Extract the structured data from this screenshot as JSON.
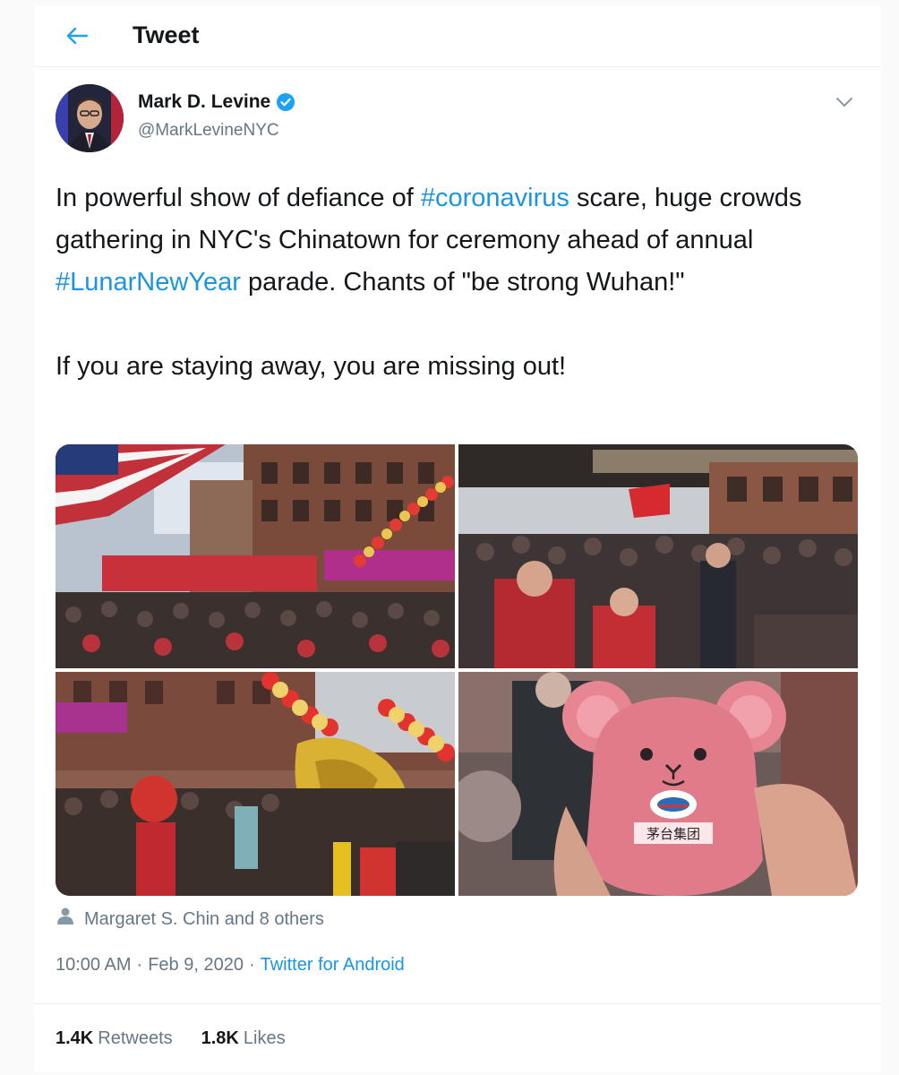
{
  "header": {
    "back_icon": "back-arrow-icon",
    "title": "Tweet"
  },
  "author": {
    "name": "Mark D. Levine",
    "handle": "@MarkLevineNYC",
    "verified_icon": "verified-badge-icon"
  },
  "tweet": {
    "line1_pre": "In powerful show of defiance of ",
    "hashtag1": "#coronavirus",
    "line1_post": " scare, huge crowds gathering in NYC's Chinatown for ceremony ahead of annual ",
    "hashtag2": "#LunarNewYear",
    "line1_end": " parade. Chants of \"be strong Wuhan!\"",
    "line2": "If you are staying away, you are missing out!"
  },
  "media": {
    "photos": [
      "street-crowd-banner-photo",
      "crowd-under-awning-photo",
      "lion-dance-balloons-photo",
      "pink-rat-mascot-photo"
    ]
  },
  "tagged": {
    "icon": "person-icon",
    "text": "Margaret S. Chin and 8 others"
  },
  "meta": {
    "time": "10:00 AM",
    "date": "Feb 9, 2020",
    "separator": "·",
    "source": "Twitter for Android"
  },
  "stats": {
    "retweets_count": "1.4K",
    "retweets_label": "Retweets",
    "likes_count": "1.8K",
    "likes_label": "Likes"
  },
  "colors": {
    "accent": "#1da1f2",
    "link": "#1b95e0",
    "secondary_text": "#657786"
  }
}
